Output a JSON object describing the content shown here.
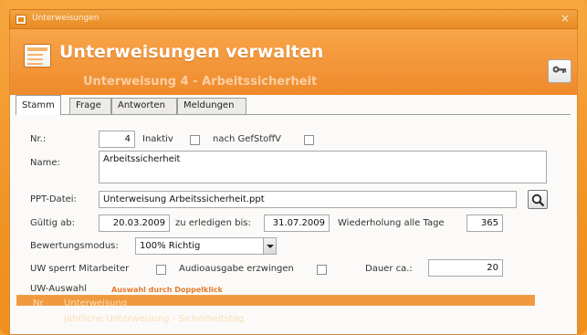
{
  "window": {
    "title": "Unterweisungen",
    "close_label": "×"
  },
  "header": {
    "title": "Unterweisungen verwalten",
    "subtitle": "Unterweisung 4 - Arbeitssicherheit",
    "action_icon": "key-icon"
  },
  "tabs": [
    {
      "label": "Stamm",
      "active": true
    },
    {
      "label": "Frage",
      "active": false
    },
    {
      "label": "Antworten",
      "active": false
    },
    {
      "label": "Meldungen",
      "active": false
    }
  ],
  "form": {
    "nr_label": "Nr.:",
    "nr_value": "4",
    "inaktiv_label": "Inaktiv",
    "inaktiv_checked": false,
    "gefstoffv_label": "nach GefStoffV",
    "gefstoffv_checked": false,
    "name_label": "Name:",
    "name_value": "Arbeitssicherheit",
    "ppt_label": "PPT-Datei:",
    "ppt_value": "Unterweisung Arbeitssicherheit.ppt",
    "browse_icon": "magnifier-icon",
    "gueltig_label": "Gültig ab:",
    "gueltig_value": "20.03.2009",
    "erledigen_label": "zu erledigen bis:",
    "erledigen_value": "31.07.2009",
    "wiederholung_label": "Wiederholung alle Tage",
    "wiederholung_value": "365",
    "bewertung_label": "Bewertungsmodus:",
    "bewertung_value": "100% Richtig",
    "uw_sperrt_label": "UW sperrt Mitarbeiter",
    "uw_sperrt_checked": false,
    "audio_label": "Audioausgabe erzwingen",
    "audio_checked": false,
    "dauer_label": "Dauer ca.:",
    "dauer_value": "20",
    "uw_auswahl_label": "UW-Auswahl",
    "uw_auswahl_hint": "Auswahl durch Doppelklick"
  },
  "uw_list": {
    "columns": [
      "Nr",
      "Unterweisung"
    ],
    "rows": [
      {
        "nr": "",
        "name": "Jährliche Unterweisung - Sicherheitstag"
      }
    ]
  },
  "colors": {
    "accent": "#f09426",
    "header_gradient_top": "#f7a448",
    "hint": "#e6792a",
    "list_bg": "#ef9a3f"
  }
}
